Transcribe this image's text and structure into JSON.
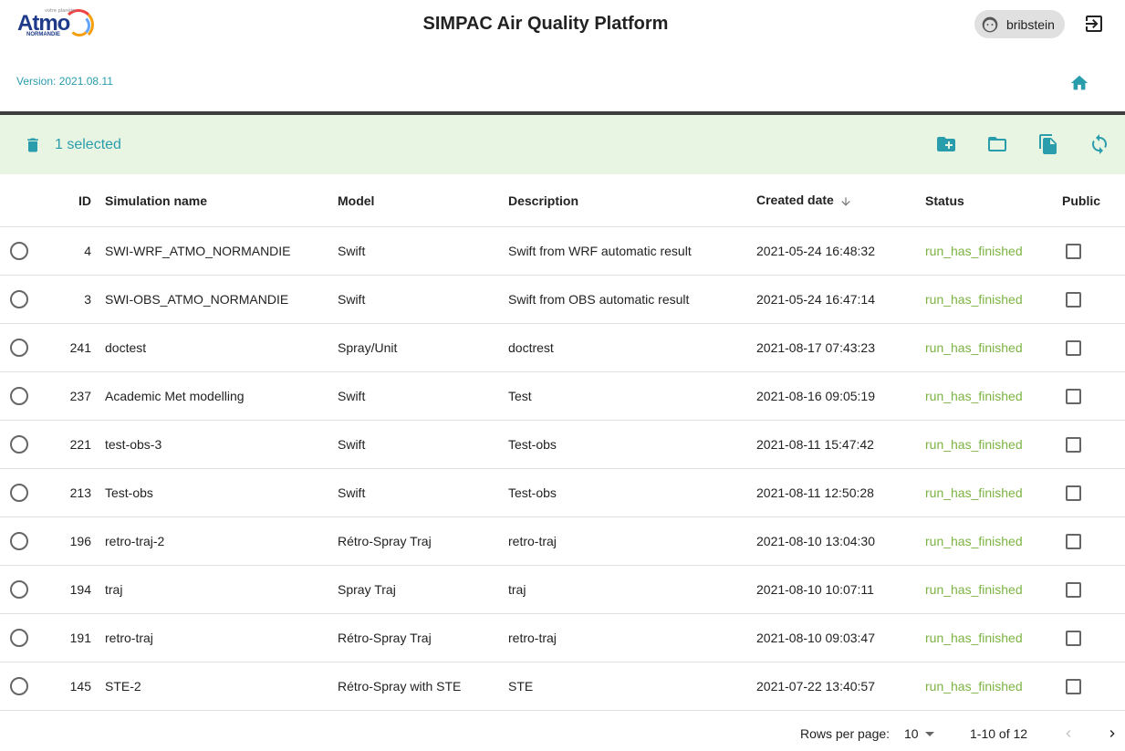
{
  "header": {
    "logo_text": "Atmo",
    "logo_tagline": "votre planète",
    "logo_sub": "NORMANDIE",
    "title": "SIMPAC Air Quality Platform",
    "username": "bribstein",
    "version": "Version: 2021.08.11"
  },
  "toolbar": {
    "selected_text": "1 selected"
  },
  "table": {
    "columns": {
      "id": "ID",
      "name": "Simulation name",
      "model": "Model",
      "description": "Description",
      "created": "Created date",
      "status": "Status",
      "public": "Public"
    },
    "rows": [
      {
        "id": "4",
        "name": "SWI-WRF_ATMO_NORMANDIE",
        "model": "Swift",
        "description": "Swift from WRF automatic result",
        "created": "2021-05-24 16:48:32",
        "status": "run_has_finished"
      },
      {
        "id": "3",
        "name": "SWI-OBS_ATMO_NORMANDIE",
        "model": "Swift",
        "description": "Swift from OBS automatic result",
        "created": "2021-05-24 16:47:14",
        "status": "run_has_finished"
      },
      {
        "id": "241",
        "name": "doctest",
        "model": "Spray/Unit",
        "description": "doctrest",
        "created": "2021-08-17 07:43:23",
        "status": "run_has_finished"
      },
      {
        "id": "237",
        "name": "Academic Met modelling",
        "model": "Swift",
        "description": "Test",
        "created": "2021-08-16 09:05:19",
        "status": "run_has_finished"
      },
      {
        "id": "221",
        "name": "test-obs-3",
        "model": "Swift",
        "description": "Test-obs",
        "created": "2021-08-11 15:47:42",
        "status": "run_has_finished"
      },
      {
        "id": "213",
        "name": "Test-obs",
        "model": "Swift",
        "description": "Test-obs",
        "created": "2021-08-11 12:50:28",
        "status": "run_has_finished"
      },
      {
        "id": "196",
        "name": "retro-traj-2",
        "model": "Rétro-Spray Traj",
        "description": "retro-traj",
        "created": "2021-08-10 13:04:30",
        "status": "run_has_finished"
      },
      {
        "id": "194",
        "name": "traj",
        "model": "Spray Traj",
        "description": "traj",
        "created": "2021-08-10 10:07:11",
        "status": "run_has_finished"
      },
      {
        "id": "191",
        "name": "retro-traj",
        "model": "Rétro-Spray Traj",
        "description": "retro-traj",
        "created": "2021-08-10 09:03:47",
        "status": "run_has_finished"
      },
      {
        "id": "145",
        "name": "STE-2",
        "model": "Rétro-Spray with STE",
        "description": "STE",
        "created": "2021-07-22 13:40:57",
        "status": "run_has_finished"
      }
    ]
  },
  "pagination": {
    "rows_per_page_label": "Rows per page:",
    "rows_per_page": "10",
    "range": "1-10 of 12"
  },
  "colors": {
    "accent": "#2a9dad",
    "status_ok": "#7cb342",
    "toolbar_bg": "#e9f5e3"
  }
}
